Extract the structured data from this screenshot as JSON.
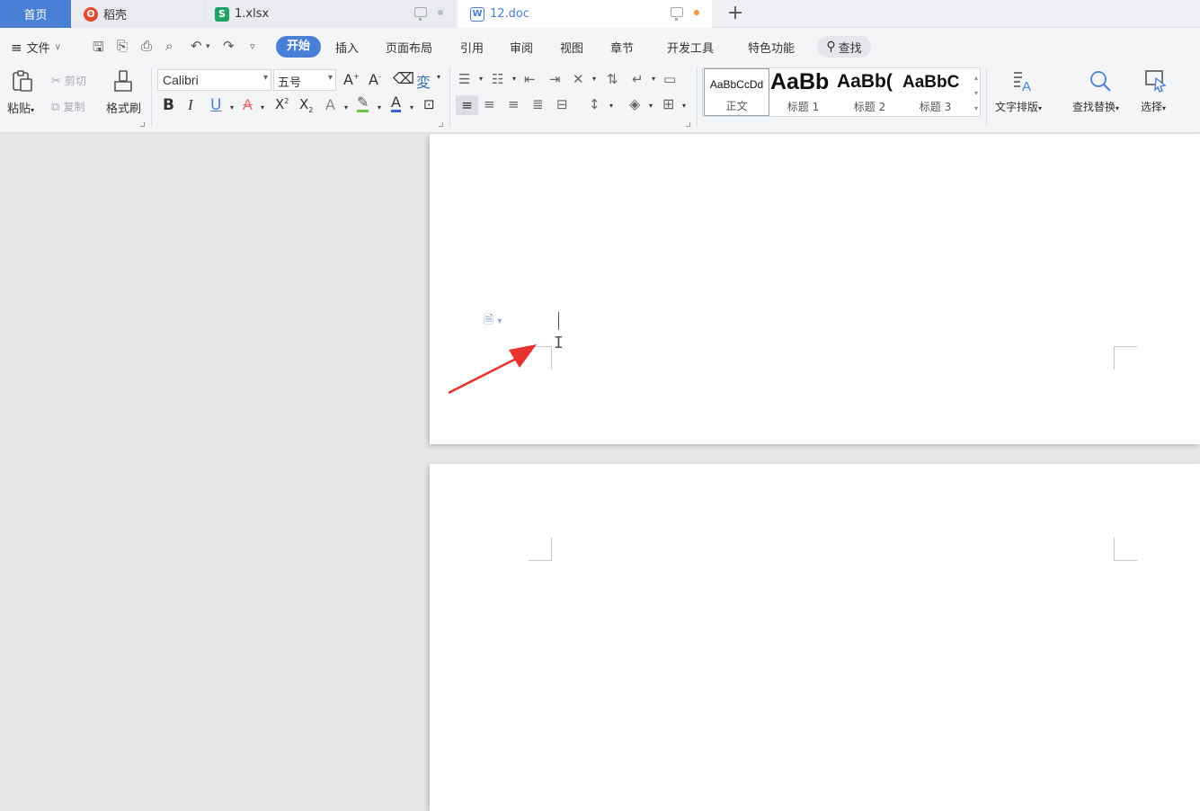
{
  "tabs": [
    {
      "label": "首页"
    },
    {
      "label": "稻壳"
    },
    {
      "label": "1.xlsx"
    },
    {
      "label": "12.doc"
    }
  ],
  "menu": {
    "file": "文件",
    "start": "开始",
    "items": [
      "插入",
      "页面布局",
      "引用",
      "审阅",
      "视图",
      "章节",
      "开发工具",
      "特色功能"
    ],
    "search": "查找"
  },
  "ribbon": {
    "paste": "粘贴",
    "cut": "剪切",
    "copy": "复制",
    "format_painter": "格式刷",
    "font_name": "Calibri",
    "font_size": "五号",
    "styles": [
      {
        "sample": "AaBbCcDd",
        "name": "正文"
      },
      {
        "sample": "AaBb",
        "name": "标题 1"
      },
      {
        "sample": "AaBb(",
        "name": "标题 2"
      },
      {
        "sample": "AaBbC",
        "name": "标题 3"
      }
    ],
    "text_layout": "文字排版",
    "find_replace": "查找替换",
    "select": "选择"
  },
  "colors": {
    "accent": "#4a7fd6",
    "annotation_arrow": "#e8322d"
  }
}
